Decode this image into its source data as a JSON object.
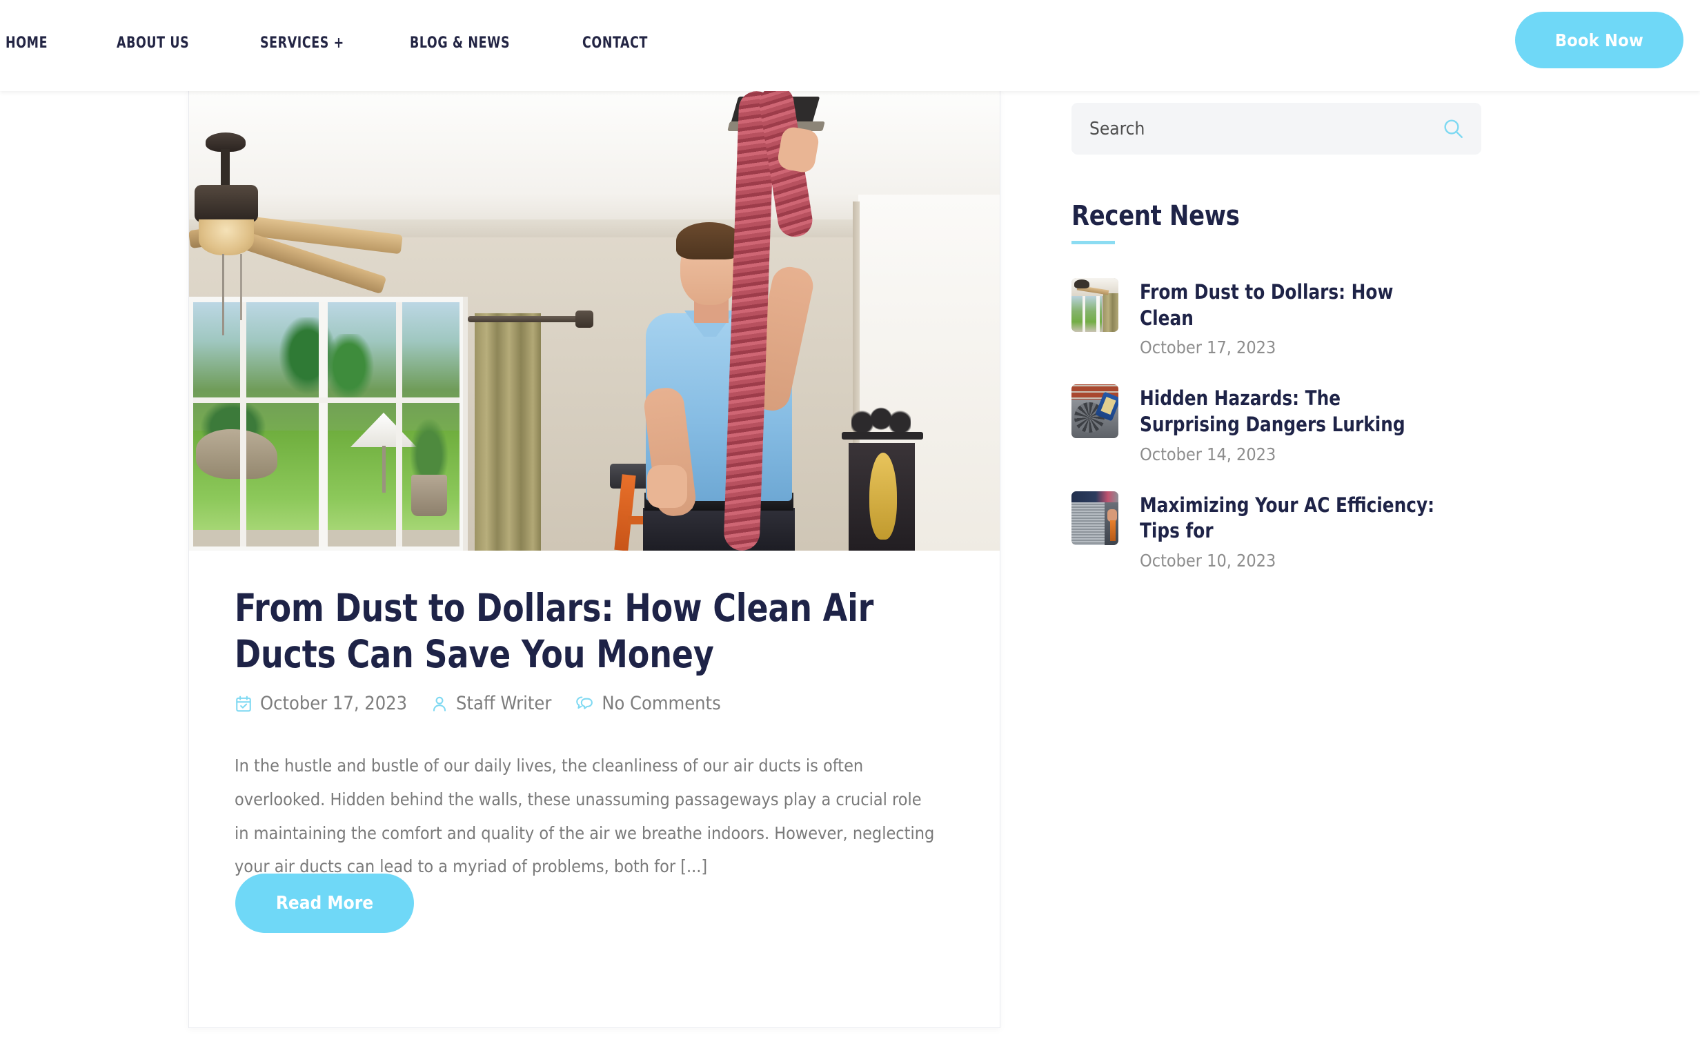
{
  "header": {
    "nav": [
      {
        "label": "HOME",
        "name": "nav-item-home"
      },
      {
        "label": "ABOUT US",
        "name": "nav-item-about-us"
      },
      {
        "label": "SERVICES +",
        "name": "nav-item-services"
      },
      {
        "label": "BLOG & NEWS",
        "name": "nav-item-blog-news"
      },
      {
        "label": "CONTACT",
        "name": "nav-item-contact"
      }
    ],
    "book_now_label": "Book Now"
  },
  "article": {
    "title": "From Dust to Dollars: How Clean Air Ducts Can Save You Money",
    "meta": {
      "date": "October 17, 2023",
      "author": "Staff Writer",
      "comments": "No Comments"
    },
    "excerpt": "In the hustle and bustle of our daily lives, the cleanliness of our air ducts is often overlooked. Hidden behind the walls, these unassuming passageways play a crucial role in maintaining the comfort and quality of the air we breathe indoors. However, neglecting your air ducts can lead to a myriad of problems, both for [...]",
    "read_more_label": "Read More",
    "featured_image_alt": "Technician in blue polo shirt cleaning a ceiling air duct with a red vacuum hose while standing on an orange step ladder"
  },
  "sidebar": {
    "search": {
      "placeholder": "Search",
      "value": ""
    },
    "recent_news_title": "Recent News",
    "news": [
      {
        "title": "From Dust to Dollars: How Clean",
        "date": "October 17, 2023",
        "thumb_alt": "Living room with ceiling fan and sliding glass doors"
      },
      {
        "title": "Hidden Hazards: The Surprising Dangers Lurking",
        "date": "October 14, 2023",
        "thumb_alt": "Outdoor AC condenser fan beside a brick wall"
      },
      {
        "title": "Maximizing Your AC Efficiency: Tips for",
        "date": "October 10, 2023",
        "thumb_alt": "Technician servicing air conditioner coil fins"
      }
    ]
  },
  "colors": {
    "accent_blue": "#6fd8f7",
    "heading_navy": "#1e2347",
    "body_gray": "#7a7a7a",
    "search_bg": "#f4f5f7",
    "rule_blue": "#8bdcf2"
  }
}
